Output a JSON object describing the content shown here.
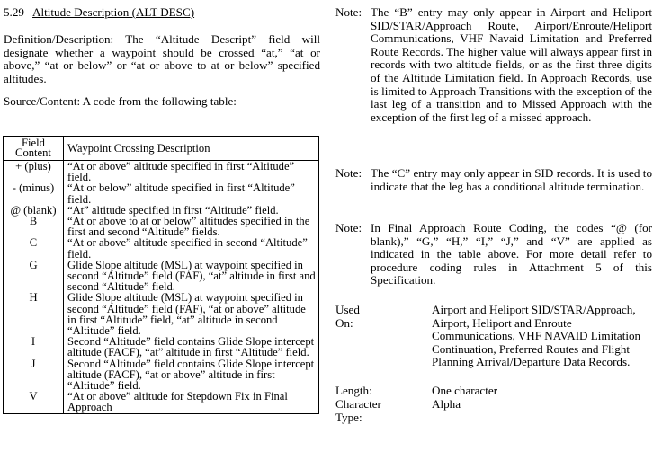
{
  "section": {
    "number": "5.29",
    "title": "Altitude Description (ALT DESC)"
  },
  "definition": "Definition/Description:  The “Altitude Descript” field will designate whether a waypoint should be crossed “at,” “at or above,” “at or below” or “at or above to at or below” specified altitudes.",
  "source": "Source/Content:  A code from the following table:",
  "table": {
    "header_code": "Field Content",
    "header_desc": "Waypoint Crossing Description",
    "rows": [
      {
        "code": "+ (plus)",
        "desc": "“At or above” altitude specified in first “Altitude” field."
      },
      {
        "code": "- (minus)",
        "desc": "“At or below” altitude specified in first “Altitude” field."
      },
      {
        "code": "@ (blank)",
        "desc": "“At” altitude specified in first “Altitude” field."
      },
      {
        "code": "B",
        "desc": "“At or above to at or below” altitudes specified in the first and second “Altitude” fields."
      },
      {
        "code": "C",
        "desc": "“At or above” altitude specified in second “Altitude” field."
      },
      {
        "code": "G",
        "desc": "Glide Slope altitude (MSL) at waypoint specified in second “Altitude” field (FAF), “at” altitude in first and second “Altitude” field."
      },
      {
        "code": "H",
        "desc": "Glide Slope altitude (MSL) at waypoint specified in second “Altitude” field (FAF), “at or above” altitude in first “Altitude” field, “at” altitude in second “Altitude” field."
      },
      {
        "code": "I",
        "desc": "Second “Altitude” field contains Glide Slope intercept altitude (FACF), “at” altitude in first “Altitude” field."
      },
      {
        "code": "J",
        "desc": "Second “Altitude” field contains Glide Slope intercept altitude (FACF), “at or above” altitude in first “Altitude” field."
      },
      {
        "code": "V",
        "desc": "“At or above” altitude for Stepdown Fix in Final Approach"
      }
    ]
  },
  "notes": [
    {
      "label": "Note:",
      "text": "The “B” entry may only appear in Airport and Heliport SID/STAR/Approach Route, Airport/Enroute/Heliport Communications, VHF Navaid Limitation and Preferred Route Records. The higher value will always appear first in records with two altitude fields, or as the first three digits of the Altitude Limitation field. In Approach Records, use is limited to Approach Transitions with the exception of the last leg of a transition and to Missed Approach with the exception of the first leg of a missed approach."
    },
    {
      "label": "Note:",
      "text": "The “C” entry may only appear in SID records. It is used to indicate that the leg has a conditional altitude termination."
    },
    {
      "label": "Note:",
      "text": "In Final Approach Route Coding, the codes “@ (for blank),” “G,” “H,” “I,” “J,” and “V” are applied as indicated in the table above. For more detail refer to procedure coding rules in Attachment 5 of this Specification."
    }
  ],
  "used_on": {
    "label": "Used On:",
    "value": "Airport and Heliport SID/STAR/Approach, Airport, Heliport and Enroute Communications, VHF NAVAID Limitation Continuation, Preferred Routes and Flight Planning Arrival/Departure Data Records."
  },
  "length": {
    "label": "Length:",
    "value": "One character"
  },
  "character_type": {
    "label": "Character Type:",
    "value": "Alpha"
  }
}
